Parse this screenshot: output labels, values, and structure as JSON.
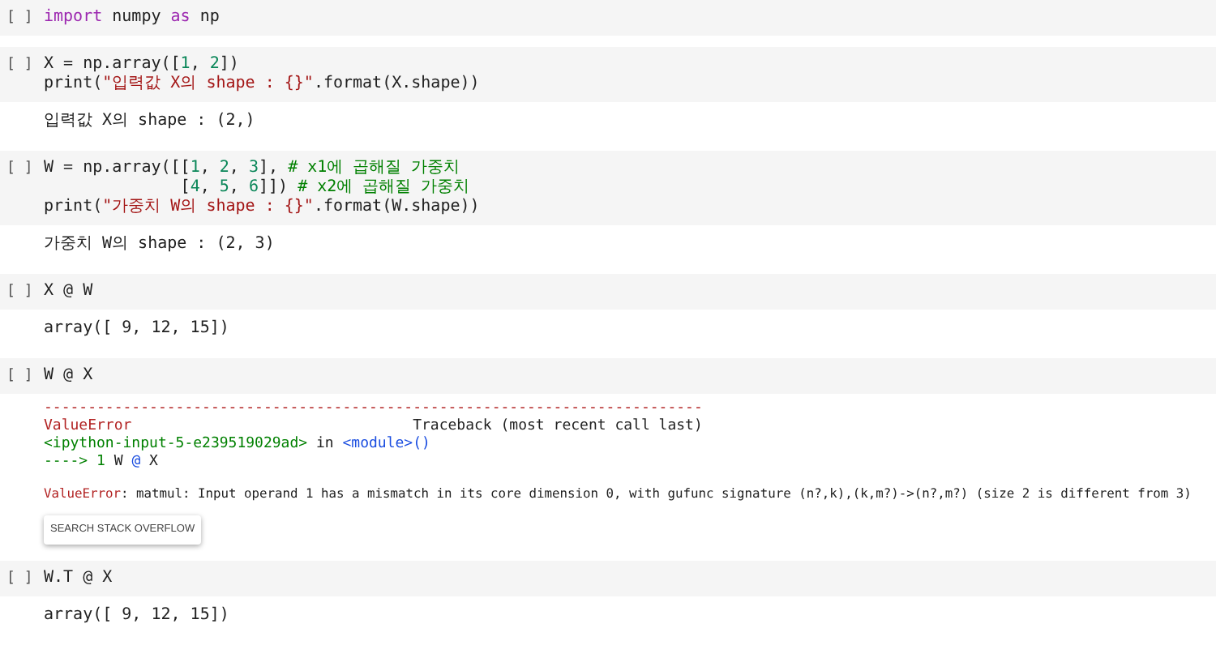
{
  "cells": [
    {
      "prompt": "[ ]",
      "code": [
        [
          {
            "text": "import",
            "kind": "keyword"
          },
          {
            "text": " numpy ",
            "kind": "plain"
          },
          {
            "text": "as",
            "kind": "keyword"
          },
          {
            "text": " np",
            "kind": "plain"
          }
        ]
      ]
    },
    {
      "prompt": "[ ]",
      "code": [
        [
          {
            "text": "X = np.array([",
            "kind": "plain"
          },
          {
            "text": "1",
            "kind": "number"
          },
          {
            "text": ", ",
            "kind": "plain"
          },
          {
            "text": "2",
            "kind": "number"
          },
          {
            "text": "])",
            "kind": "plain"
          }
        ],
        [
          {
            "text": "print(",
            "kind": "plain"
          },
          {
            "text": "\"입력값 X의 shape : {}\"",
            "kind": "string"
          },
          {
            "text": ".format(X.shape))",
            "kind": "plain"
          }
        ]
      ],
      "outputs": [
        {
          "kind": "text",
          "lines": [
            "입력값 X의 shape : (2,)"
          ]
        }
      ]
    },
    {
      "prompt": "[ ]",
      "code": [
        [
          {
            "text": "W = np.array([[",
            "kind": "plain"
          },
          {
            "text": "1",
            "kind": "number"
          },
          {
            "text": ", ",
            "kind": "plain"
          },
          {
            "text": "2",
            "kind": "number"
          },
          {
            "text": ", ",
            "kind": "plain"
          },
          {
            "text": "3",
            "kind": "number"
          },
          {
            "text": "], ",
            "kind": "plain"
          },
          {
            "text": "# x1에 곱해질 가중치",
            "kind": "comment"
          }
        ],
        [
          {
            "text": "              [",
            "kind": "plain"
          },
          {
            "text": "4",
            "kind": "number"
          },
          {
            "text": ", ",
            "kind": "plain"
          },
          {
            "text": "5",
            "kind": "number"
          },
          {
            "text": ", ",
            "kind": "plain"
          },
          {
            "text": "6",
            "kind": "number"
          },
          {
            "text": "]]) ",
            "kind": "plain"
          },
          {
            "text": "# x2에 곱해질 가중치",
            "kind": "comment"
          }
        ],
        [
          {
            "text": "print(",
            "kind": "plain"
          },
          {
            "text": "\"가중치 W의 shape : {}\"",
            "kind": "string"
          },
          {
            "text": ".format(W.shape))",
            "kind": "plain"
          }
        ]
      ],
      "outputs": [
        {
          "kind": "text",
          "lines": [
            "가중치 W의 shape : (2, 3)"
          ]
        }
      ]
    },
    {
      "prompt": "[ ]",
      "code": [
        [
          {
            "text": "X @ W",
            "kind": "plain"
          }
        ]
      ],
      "outputs": [
        {
          "kind": "text",
          "lines": [
            "array([ 9, 12, 15])"
          ]
        }
      ]
    },
    {
      "prompt": "[ ]",
      "code": [
        [
          {
            "text": "W @ X",
            "kind": "plain"
          }
        ]
      ],
      "outputs": [
        {
          "kind": "error",
          "lines": [
            [
              {
                "text": "---------------------------------------------------------------------------",
                "kind": "error"
              }
            ],
            [
              {
                "text": "ValueError",
                "kind": "error"
              },
              {
                "text": "                                Traceback (most recent call last)",
                "kind": "plain"
              }
            ],
            [
              {
                "text": "<ipython-input-5-e239519029ad>",
                "kind": "comment"
              },
              {
                "text": " in ",
                "kind": "plain"
              },
              {
                "text": "<module>",
                "kind": "link"
              },
              {
                "text": "()",
                "kind": "link"
              }
            ],
            [
              {
                "text": "----> 1 ",
                "kind": "comment"
              },
              {
                "text": "W ",
                "kind": "plain"
              },
              {
                "text": "@",
                "kind": "link"
              },
              {
                "text": " X",
                "kind": "plain"
              }
            ]
          ],
          "message": [
            {
              "text": "ValueError",
              "kind": "error"
            },
            {
              "text": ": matmul: Input operand 1 has a mismatch in its core dimension 0, with gufunc signature (n?,k),(k,m?)->(n?,m?) (size 2 is different from 3)",
              "kind": "plain"
            }
          ],
          "button": "SEARCH STACK OVERFLOW"
        }
      ]
    },
    {
      "prompt": "[ ]",
      "code": [
        [
          {
            "text": "W.T @ X",
            "kind": "plain"
          }
        ]
      ],
      "outputs": [
        {
          "kind": "text",
          "lines": [
            "array([ 9, 12, 15])"
          ]
        }
      ]
    }
  ]
}
